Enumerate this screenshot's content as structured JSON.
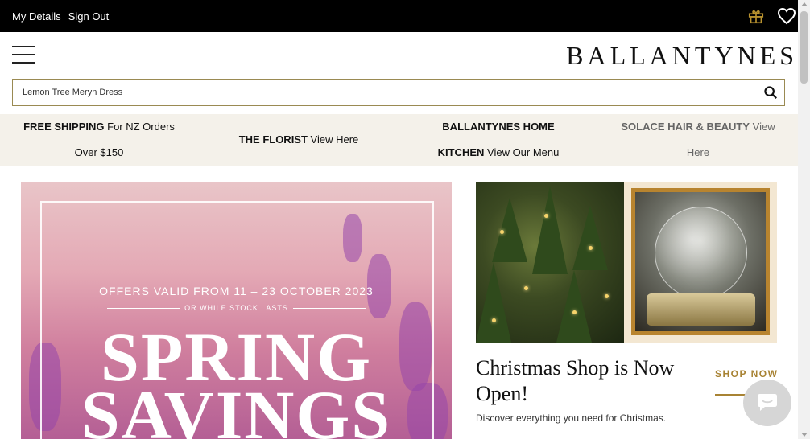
{
  "topbar": {
    "my_details": "My Details",
    "sign_out": "Sign Out",
    "icons": [
      "gift-icon",
      "heart-icon"
    ]
  },
  "header": {
    "logo": "BALLANTYNES"
  },
  "search": {
    "value": "Lemon Tree Meryn Dress"
  },
  "promo": {
    "shipping_bold": "FREE SHIPPING",
    "shipping_text": "For NZ Orders",
    "shipping_text2": "Over $150",
    "florist_bold": "THE FLORIST",
    "florist_text": "View Here",
    "home_bold": "BALLANTYNES HOME",
    "kitchen_bold": "KITCHEN",
    "kitchen_text": "View Our Menu",
    "solace_bold": "SOLACE HAIR & BEAUTY",
    "solace_text": "View",
    "solace_text2": "Here"
  },
  "hero": {
    "offers": "OFFERS VALID FROM 11 – 23 OCTOBER 2023",
    "stock": "OR WHILE STOCK LASTS",
    "line1": "SPRING",
    "line2": "SAVINGS"
  },
  "christmas": {
    "title": "Christmas Shop is Now Open!",
    "shop_now": "SHOP NOW",
    "description": "Discover everything you need for Christmas."
  },
  "colors": {
    "accent_gold": "#a88334",
    "promo_bg": "#f4f1ea",
    "topbar_bg": "#000000"
  }
}
